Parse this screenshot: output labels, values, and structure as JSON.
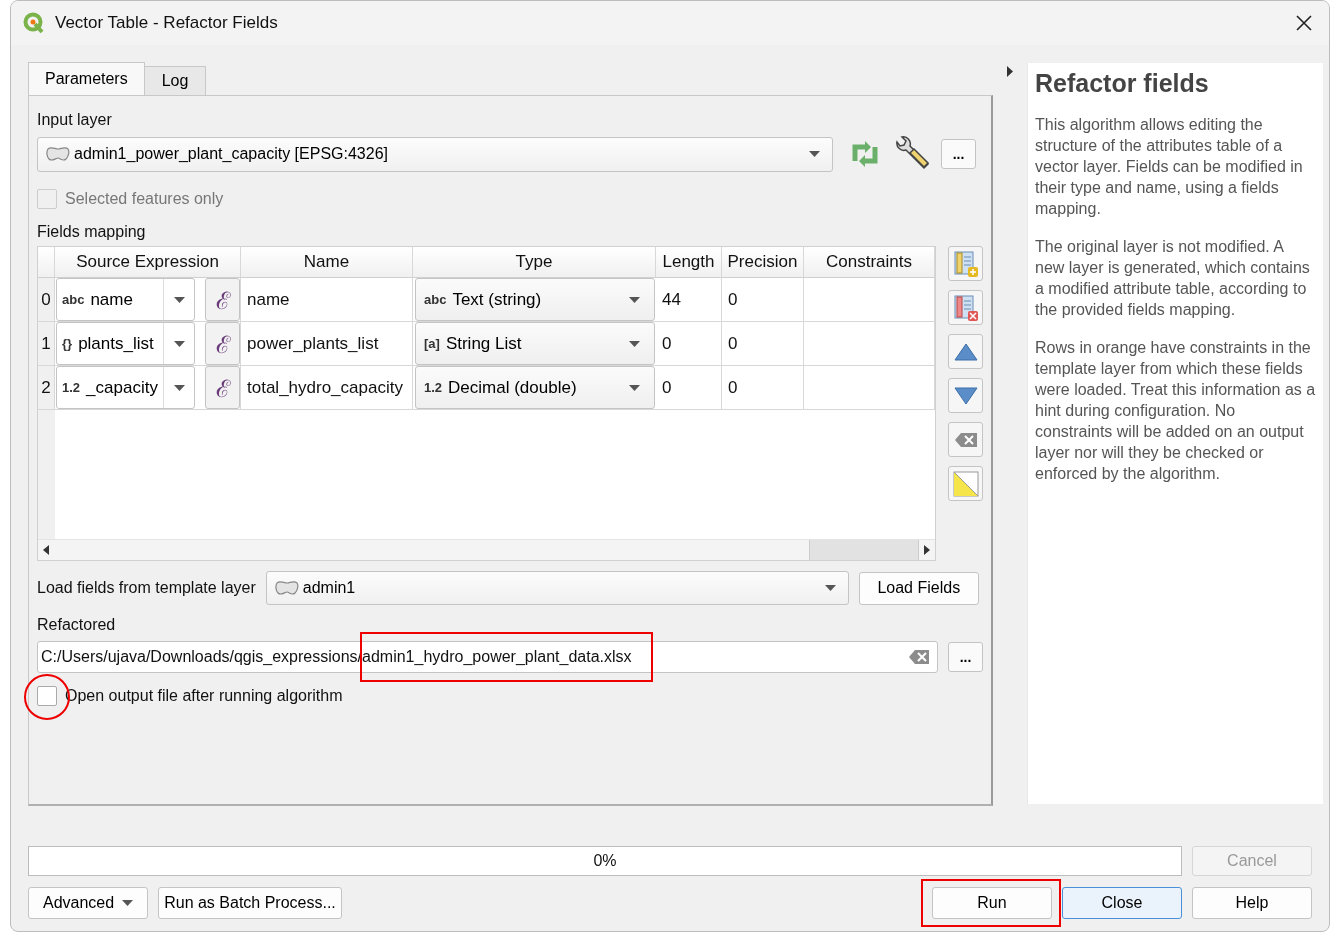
{
  "window": {
    "title": "Vector Table - Refactor Fields"
  },
  "tabs": [
    {
      "label": "Parameters",
      "selected": true
    },
    {
      "label": "Log",
      "selected": false
    }
  ],
  "input_layer": {
    "label": "Input layer",
    "value": "admin1_power_plant_capacity [EPSG:4326]",
    "more_button": "..."
  },
  "selected_features": {
    "label": "Selected features only",
    "checked": false,
    "disabled": true
  },
  "fields_mapping": {
    "label": "Fields mapping",
    "columns": [
      "Source Expression",
      "Name",
      "Type",
      "Length",
      "Precision",
      "Constraints"
    ],
    "rows": [
      {
        "index": "0",
        "source_badge": "abc",
        "source": "name",
        "expression_button": "ℰ",
        "name": "name",
        "type_badge": "abc",
        "type": "Text (string)",
        "length": "44",
        "precision": "0"
      },
      {
        "index": "1",
        "source_badge": "{}",
        "source": "plants_list",
        "expression_button": "ℰ",
        "name": "power_plants_list",
        "type_badge": "[a]",
        "type": "String List",
        "length": "0",
        "precision": "0"
      },
      {
        "index": "2",
        "source_badge": "1.2",
        "source": "_capacity",
        "expression_button": "ℰ",
        "name": "total_hydro_capacity",
        "type_badge": "1.2",
        "type": "Decimal (double)",
        "length": "0",
        "precision": "0"
      }
    ]
  },
  "template": {
    "label": "Load fields from template layer",
    "value": "admin1",
    "button": "Load Fields"
  },
  "output": {
    "label": "Refactored",
    "value": "C:/Users/ujava/Downloads/qgis_expressions/admin1_hydro_power_plant_data.xlsx",
    "more_button": "...",
    "highlighted": true
  },
  "open_output": {
    "label": "Open output file after running algorithm",
    "checked": false,
    "highlighted": true
  },
  "help": {
    "title": "Refactor fields",
    "paragraphs": [
      "This algorithm allows editing the structure of the attributes table of a vector layer. Fields can be modified in their type and name, using a fields mapping.",
      "The original layer is not modified. A new layer is generated, which contains a modified attribute table, according to the provided fields mapping.",
      "Rows in orange have constraints in the template layer from which these fields were loaded. Treat this information as a hint during configuration. No constraints will be added on an output layer nor will they be checked or enforced by the algorithm."
    ]
  },
  "footer": {
    "progress": {
      "level": 0,
      "text": "0%"
    },
    "cancel": {
      "label": "Cancel",
      "disabled": true
    },
    "left_buttons": [
      {
        "label": "Advanced",
        "kind": "menu"
      },
      {
        "label": "Run as Batch Process...",
        "kind": "push"
      }
    ],
    "right_buttons": [
      {
        "label": "Run",
        "default": false,
        "highlighted": true
      },
      {
        "label": "Close",
        "default": true,
        "highlighted": false
      },
      {
        "label": "Help",
        "default": false,
        "highlighted": false
      }
    ]
  }
}
